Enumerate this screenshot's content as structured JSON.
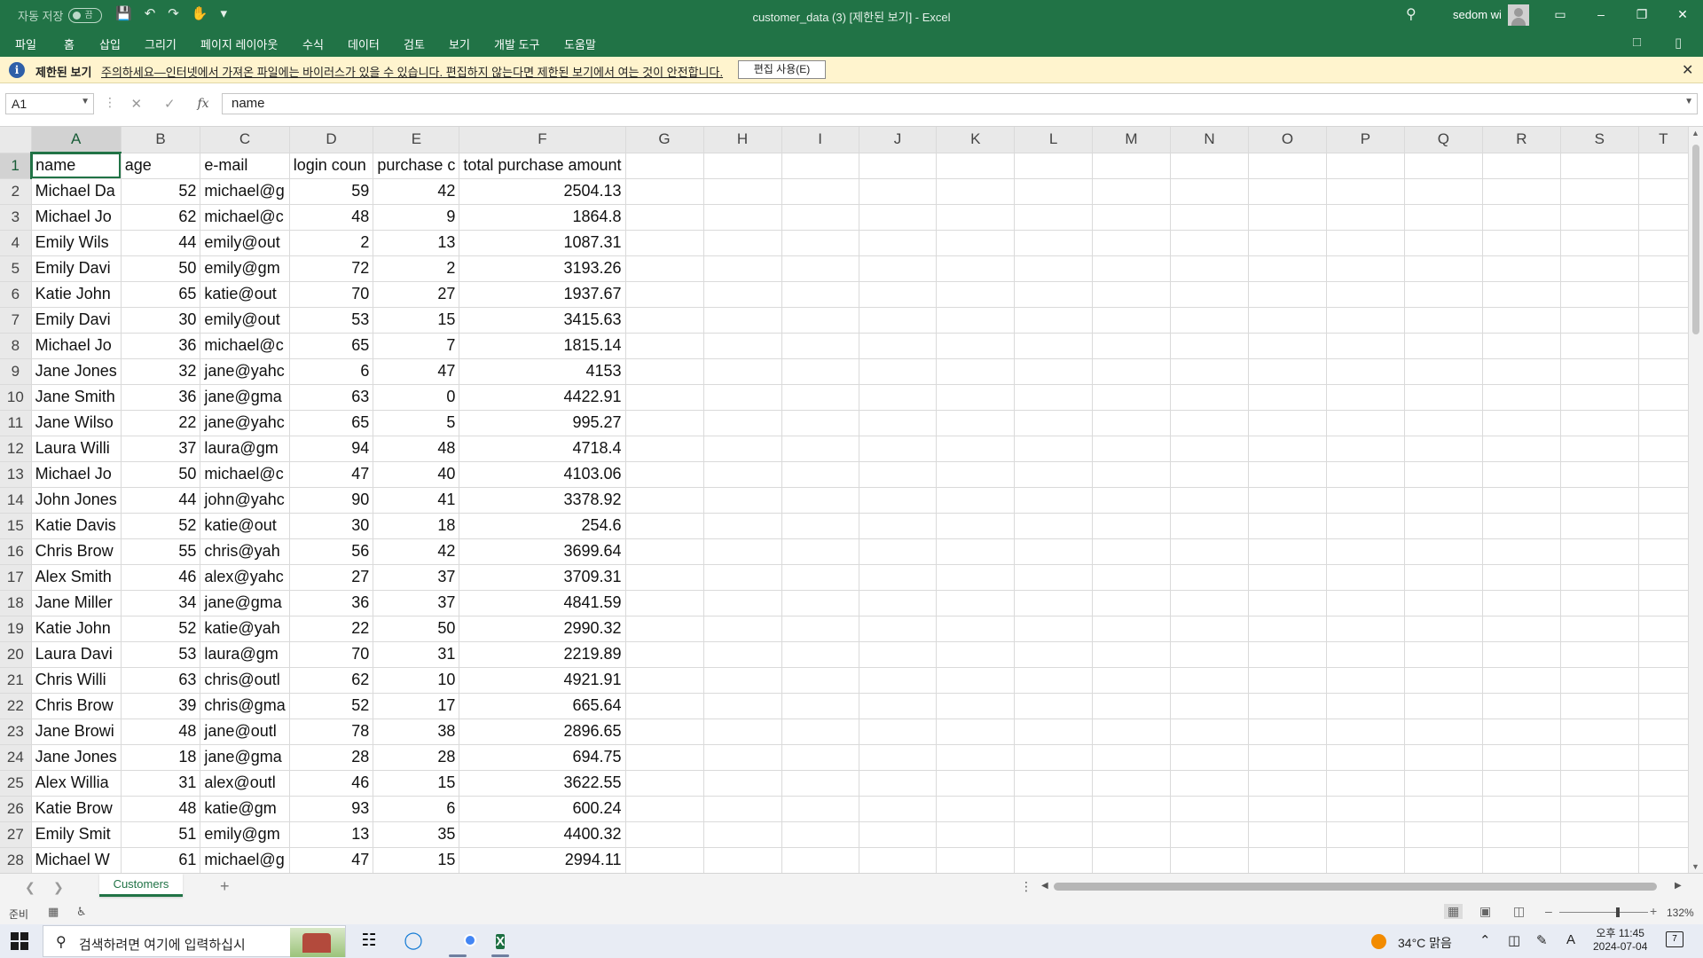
{
  "titlebar": {
    "autosave_label": "자동 저장",
    "autosave_state": "끔",
    "doc_title": "customer_data (3)  [제한된 보기]  -  Excel",
    "user_name": "sedom wi"
  },
  "ribbon": {
    "tabs": [
      "파일",
      "홈",
      "삽입",
      "그리기",
      "페이지 레이아웃",
      "수식",
      "데이터",
      "검토",
      "보기",
      "개발 도구",
      "도움말"
    ]
  },
  "protected_view": {
    "label": "제한된 보기",
    "message": "주의하세요—인터넷에서 가져온 파일에는 바이러스가 있을 수 있습니다. 편집하지 않는다면 제한된 보기에서 여는 것이 안전합니다.",
    "enable_button": "편집 사용(E)"
  },
  "formula_bar": {
    "name_box": "A1",
    "formula": "name"
  },
  "sheet": {
    "columns": [
      "A",
      "B",
      "C",
      "D",
      "E",
      "F",
      "G",
      "H",
      "I",
      "J",
      "K",
      "L",
      "M",
      "N",
      "O",
      "P",
      "Q",
      "R",
      "S",
      "T"
    ],
    "header": [
      "name",
      "age",
      "e-mail",
      "login coun",
      "purchase c",
      "total purchase amount"
    ],
    "rows": [
      [
        "Michael Da",
        "52",
        "michael@g",
        "59",
        "42",
        "2504.13"
      ],
      [
        "Michael Jo",
        "62",
        "michael@c",
        "48",
        "9",
        "1864.8"
      ],
      [
        "Emily Wils",
        "44",
        "emily@out",
        "2",
        "13",
        "1087.31"
      ],
      [
        "Emily Davi",
        "50",
        "emily@gm",
        "72",
        "2",
        "3193.26"
      ],
      [
        "Katie John",
        "65",
        "katie@out",
        "70",
        "27",
        "1937.67"
      ],
      [
        "Emily Davi",
        "30",
        "emily@out",
        "53",
        "15",
        "3415.63"
      ],
      [
        "Michael Jo",
        "36",
        "michael@c",
        "65",
        "7",
        "1815.14"
      ],
      [
        "Jane Jones",
        "32",
        "jane@yahc",
        "6",
        "47",
        "4153"
      ],
      [
        "Jane Smith",
        "36",
        "jane@gma",
        "63",
        "0",
        "4422.91"
      ],
      [
        "Jane Wilso",
        "22",
        "jane@yahc",
        "65",
        "5",
        "995.27"
      ],
      [
        "Laura Willi",
        "37",
        "laura@gm",
        "94",
        "48",
        "4718.4"
      ],
      [
        "Michael Jo",
        "50",
        "michael@c",
        "47",
        "40",
        "4103.06"
      ],
      [
        "John Jones",
        "44",
        "john@yahc",
        "90",
        "41",
        "3378.92"
      ],
      [
        "Katie Davis",
        "52",
        "katie@out",
        "30",
        "18",
        "254.6"
      ],
      [
        "Chris Brow",
        "55",
        "chris@yah",
        "56",
        "42",
        "3699.64"
      ],
      [
        "Alex Smith",
        "46",
        "alex@yahc",
        "27",
        "37",
        "3709.31"
      ],
      [
        "Jane Miller",
        "34",
        "jane@gma",
        "36",
        "37",
        "4841.59"
      ],
      [
        "Katie John",
        "52",
        "katie@yah",
        "22",
        "50",
        "2990.32"
      ],
      [
        "Laura Davi",
        "53",
        "laura@gm",
        "70",
        "31",
        "2219.89"
      ],
      [
        "Chris Willi",
        "63",
        "chris@outl",
        "62",
        "10",
        "4921.91"
      ],
      [
        "Chris Brow",
        "39",
        "chris@gma",
        "52",
        "17",
        "665.64"
      ],
      [
        "Jane Browi",
        "48",
        "jane@outl",
        "78",
        "38",
        "2896.65"
      ],
      [
        "Jane Jones",
        "18",
        "jane@gma",
        "28",
        "28",
        "694.75"
      ],
      [
        "Alex Willia",
        "31",
        "alex@outl",
        "46",
        "15",
        "3622.55"
      ],
      [
        "Katie Brow",
        "48",
        "katie@gm",
        "93",
        "6",
        "600.24"
      ],
      [
        "Emily Smit",
        "51",
        "emily@gm",
        "13",
        "35",
        "4400.32"
      ],
      [
        "Michael W",
        "61",
        "michael@g",
        "47",
        "15",
        "2994.11"
      ]
    ]
  },
  "sheet_tabs": {
    "active": "Customers"
  },
  "statusbar": {
    "ready": "준비",
    "zoom": "132%",
    "zoom_fraction": 0.66
  },
  "taskbar": {
    "search_placeholder": "검색하려면 여기에 입력하십시",
    "weather": "34°C  맑음",
    "time": "오후 11:45",
    "date": "2024-07-04",
    "ime": "A",
    "notifications": "7"
  }
}
